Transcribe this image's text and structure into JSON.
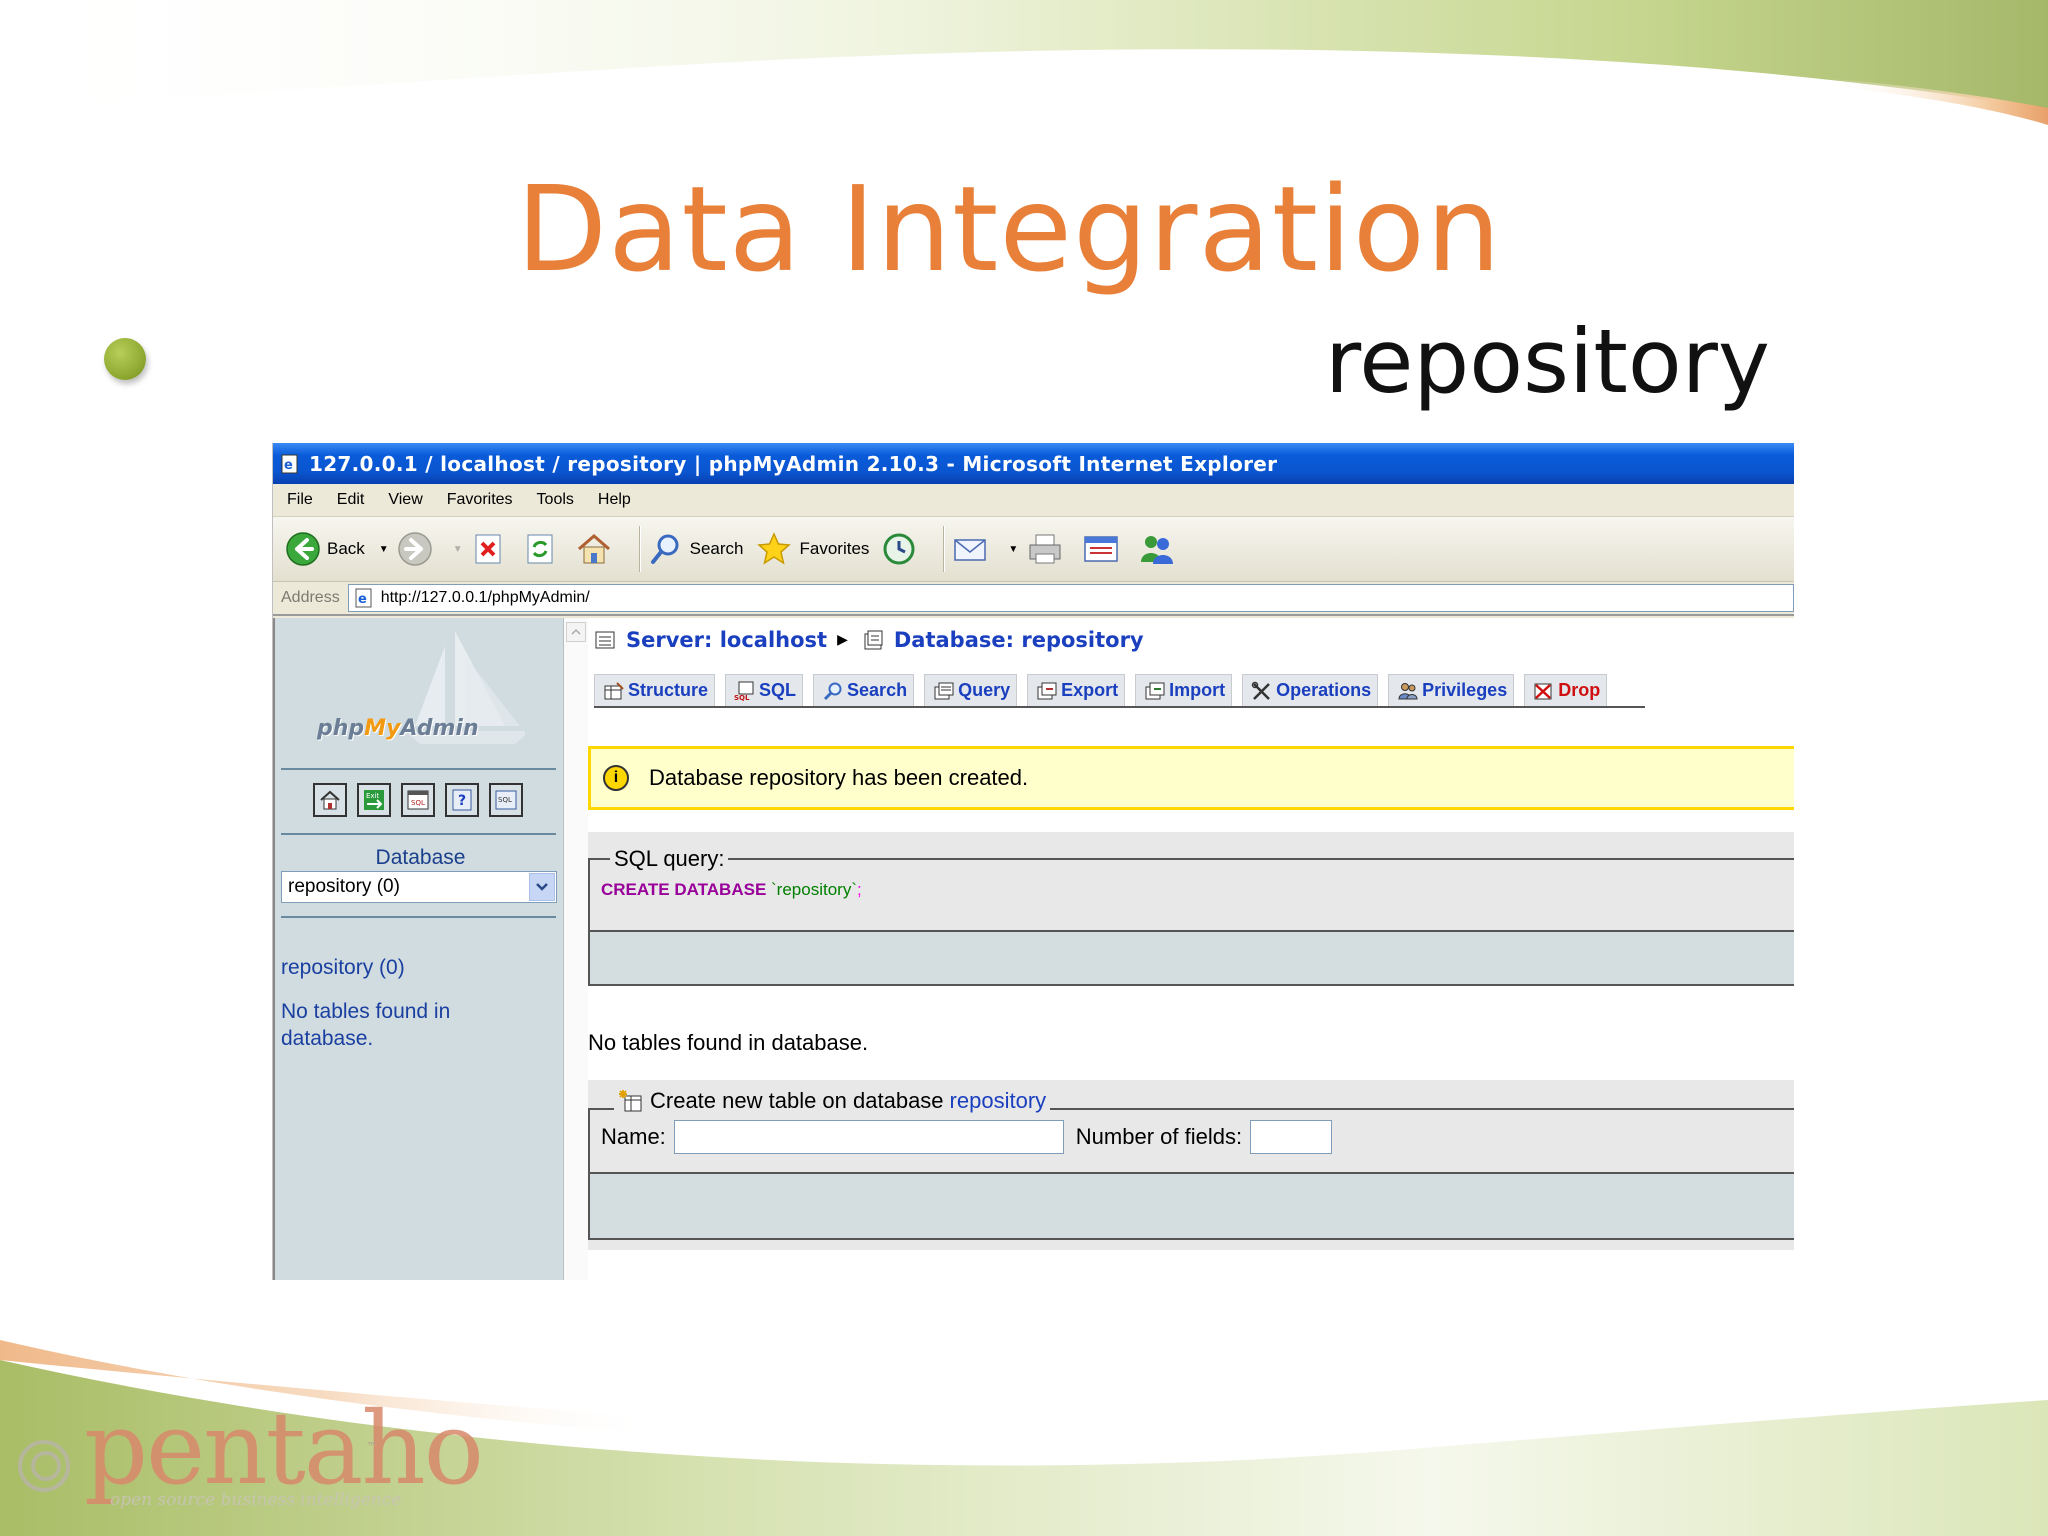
{
  "slide": {
    "title": "Data Integration",
    "bullet": "repository",
    "logo": "pentaho",
    "logo_tagline": "open source business intelligence"
  },
  "browser": {
    "title": "127.0.0.1 / localhost / repository | phpMyAdmin 2.10.3 - Microsoft Internet Explorer",
    "menu": [
      "File",
      "Edit",
      "View",
      "Favorites",
      "Tools",
      "Help"
    ],
    "toolbar": {
      "back": "Back",
      "search": "Search",
      "favorites": "Favorites"
    },
    "address_label": "Address",
    "url": "http://127.0.0.1/phpMyAdmin/"
  },
  "pma": {
    "left": {
      "logo_php": "php",
      "logo_my": "My",
      "logo_admin": "Admin",
      "database_label": "Database",
      "selected_db": "repository (0)",
      "db_link": "repository (0)",
      "no_tables": "No tables found in database."
    },
    "breadcrumb": {
      "server": "Server: localhost",
      "database": "Database: repository"
    },
    "tabs": [
      "Structure",
      "SQL",
      "Search",
      "Query",
      "Export",
      "Import",
      "Operations",
      "Privileges",
      "Drop"
    ],
    "notice": "Database repository has been created.",
    "sql_legend": "SQL query:",
    "sql": {
      "keyword": "CREATE DATABASE",
      "name": "`repository`",
      "end": ";"
    },
    "no_tables_main": "No tables found in database.",
    "create": {
      "legend": "Create new table on database",
      "db": "repository",
      "name_label": "Name:",
      "fields_label": "Number of fields:",
      "name_value": "",
      "fields_value": ""
    }
  },
  "colors": {
    "title": "#e8803a",
    "bullet": "#8aa52d",
    "link": "#1a3fbf",
    "notice_bg": "#ffffcc",
    "notice_border": "#ffd700",
    "drop": "#d01010"
  }
}
